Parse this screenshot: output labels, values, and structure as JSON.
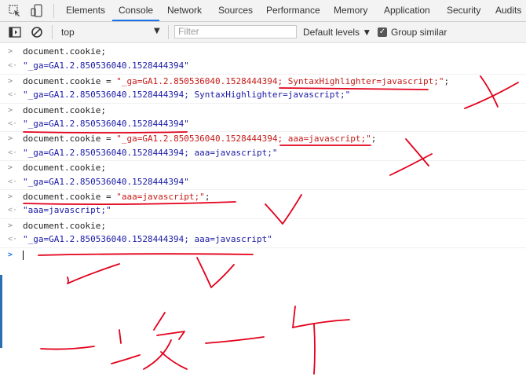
{
  "tabs": [
    {
      "label": "Elements",
      "active": false
    },
    {
      "label": "Console",
      "active": true
    },
    {
      "label": "Network",
      "active": false
    },
    {
      "label": "Sources",
      "active": false
    },
    {
      "label": "Performance",
      "active": false
    },
    {
      "label": "Memory",
      "active": false
    },
    {
      "label": "Application",
      "active": false
    },
    {
      "label": "Security",
      "active": false
    },
    {
      "label": "Audits",
      "active": false
    }
  ],
  "toolbar": {
    "context": "top",
    "filter_placeholder": "Filter",
    "levels_label": "Default levels ▼",
    "group_similar_label": "Group similar",
    "group_similar_checked": true
  },
  "console": [
    {
      "kind": "input",
      "segments": [
        {
          "t": "document.cookie;",
          "c": "plain"
        }
      ]
    },
    {
      "kind": "result",
      "segments": [
        {
          "t": "\"_ga=GA1.2.850536040.1528444394\"",
          "c": "str"
        }
      ]
    },
    {
      "kind": "input",
      "segments": [
        {
          "t": "document.cookie = ",
          "c": "plain"
        },
        {
          "t": "\"_ga=GA1.2.850536040.1528444394; SyntaxHighlighter=javascript;\"",
          "c": "str"
        },
        {
          "t": ";",
          "c": "plain"
        }
      ]
    },
    {
      "kind": "result",
      "segments": [
        {
          "t": "\"_ga=GA1.2.850536040.1528444394; SyntaxHighlighter=javascript;\"",
          "c": "str"
        }
      ]
    },
    {
      "kind": "input",
      "segments": [
        {
          "t": "document.cookie;",
          "c": "plain"
        }
      ]
    },
    {
      "kind": "result",
      "segments": [
        {
          "t": "\"_ga=GA1.2.850536040.1528444394\"",
          "c": "str"
        }
      ]
    },
    {
      "kind": "input",
      "segments": [
        {
          "t": "document.cookie = ",
          "c": "plain"
        },
        {
          "t": "\"_ga=GA1.2.850536040.1528444394; aaa=javascript;\"",
          "c": "str"
        },
        {
          "t": ";",
          "c": "plain"
        }
      ]
    },
    {
      "kind": "result",
      "segments": [
        {
          "t": "\"_ga=GA1.2.850536040.1528444394; aaa=javascript;\"",
          "c": "str"
        }
      ]
    },
    {
      "kind": "input",
      "segments": [
        {
          "t": "document.cookie;",
          "c": "plain"
        }
      ]
    },
    {
      "kind": "result",
      "segments": [
        {
          "t": "\"_ga=GA1.2.850536040.1528444394\"",
          "c": "str"
        }
      ]
    },
    {
      "kind": "input",
      "segments": [
        {
          "t": "document.cookie = ",
          "c": "plain"
        },
        {
          "t": "\"aaa=javascript;\"",
          "c": "str"
        },
        {
          "t": ";",
          "c": "plain"
        }
      ]
    },
    {
      "kind": "result",
      "segments": [
        {
          "t": "\"aaa=javascript;\"",
          "c": "str"
        }
      ]
    },
    {
      "kind": "input",
      "segments": [
        {
          "t": "document.cookie;",
          "c": "plain"
        }
      ]
    },
    {
      "kind": "result",
      "segments": [
        {
          "t": "\"_ga=GA1.2.850536040.1528444394; aaa=javascript\"",
          "c": "str"
        }
      ]
    }
  ],
  "colors": {
    "string": "#c41a16",
    "result_string": "#1a1aa6",
    "annotation_ink": "#e3001b",
    "active_tab": "#1a73e8"
  },
  "icons": [
    "inspect-icon",
    "device-toggle-icon",
    "sidebar-toggle-icon",
    "clear-console-icon",
    "prompt-chevron-icon"
  ]
}
